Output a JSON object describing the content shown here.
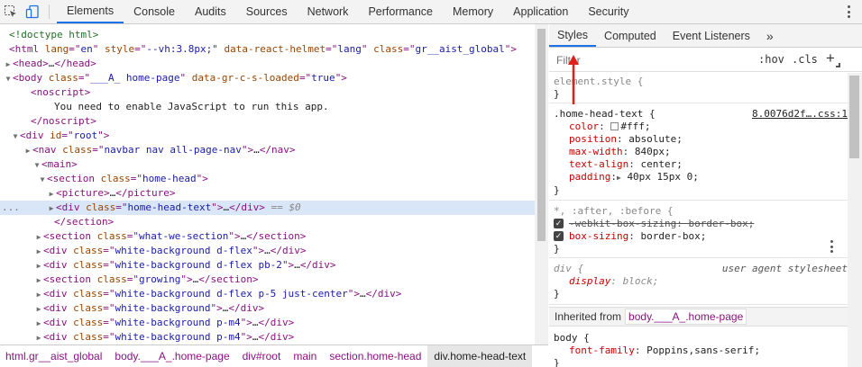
{
  "toolbar": {
    "tabs": [
      "Elements",
      "Console",
      "Audits",
      "Sources",
      "Network",
      "Performance",
      "Memory",
      "Application",
      "Security"
    ],
    "active_tab": "Elements"
  },
  "dom": {
    "lines": [
      {
        "parts": [
          [
            "c-comment",
            "<!doctype html>"
          ]
        ]
      },
      {
        "parts": [
          [
            "c-tag",
            "<html "
          ],
          [
            "c-attr",
            "lang"
          ],
          [
            "c-tag",
            "=\""
          ],
          [
            "c-val",
            "en"
          ],
          [
            "c-tag",
            "\" "
          ],
          [
            "c-attr",
            "style"
          ],
          [
            "c-tag",
            "=\""
          ],
          [
            "c-val",
            "--vh:3.8px;"
          ],
          [
            "c-tag",
            "\" "
          ],
          [
            "c-attr",
            "data-react-helmet"
          ],
          [
            "c-tag",
            "=\""
          ],
          [
            "c-val",
            "lang"
          ],
          [
            "c-tag",
            "\" "
          ],
          [
            "c-attr",
            "class"
          ],
          [
            "c-tag",
            "=\""
          ],
          [
            "c-val",
            "gr__aist_global"
          ],
          [
            "c-tag",
            "\">"
          ]
        ]
      },
      {
        "tri": "▶",
        "parts": [
          [
            "c-tag",
            "<head>"
          ],
          [
            "c-txt",
            "…"
          ],
          [
            "c-tag",
            "</head>"
          ]
        ]
      },
      {
        "tri": "▼",
        "parts": [
          [
            "c-tag",
            "<body "
          ],
          [
            "c-attr",
            "class"
          ],
          [
            "c-tag",
            "=\""
          ],
          [
            "c-val",
            "___A_ home-page"
          ],
          [
            "c-tag",
            "\" "
          ],
          [
            "c-attr",
            "data-gr-c-s-loaded"
          ],
          [
            "c-tag",
            "=\""
          ],
          [
            "c-val",
            "true"
          ],
          [
            "c-tag",
            "\">"
          ]
        ]
      },
      {
        "parts": [
          [
            "c-tag",
            "<noscript>"
          ]
        ]
      },
      {
        "parts": [
          [
            "c-txt",
            "You need to enable JavaScript to run this app."
          ]
        ]
      },
      {
        "parts": [
          [
            "c-tag",
            "</noscript>"
          ]
        ]
      },
      {
        "tri": "▼",
        "parts": [
          [
            "c-tag",
            "<div "
          ],
          [
            "c-attr",
            "id"
          ],
          [
            "c-tag",
            "=\""
          ],
          [
            "c-val",
            "root"
          ],
          [
            "c-tag",
            "\">"
          ]
        ]
      },
      {
        "tri": "▶",
        "parts": [
          [
            "c-tag",
            "<nav "
          ],
          [
            "c-attr",
            "class"
          ],
          [
            "c-tag",
            "=\""
          ],
          [
            "c-val",
            "navbar nav all-page-nav"
          ],
          [
            "c-tag",
            "\">"
          ],
          [
            "c-txt",
            "…"
          ],
          [
            "c-tag",
            "</nav>"
          ]
        ]
      },
      {
        "tri": "▼",
        "parts": [
          [
            "c-tag",
            "<main>"
          ]
        ]
      },
      {
        "tri": "▼",
        "parts": [
          [
            "c-tag",
            "<section "
          ],
          [
            "c-attr",
            "class"
          ],
          [
            "c-tag",
            "=\""
          ],
          [
            "c-val",
            "home-head"
          ],
          [
            "c-tag",
            "\">"
          ]
        ]
      },
      {
        "tri": "▶",
        "parts": [
          [
            "c-tag",
            "<picture>"
          ],
          [
            "c-txt",
            "…"
          ],
          [
            "c-tag",
            "</picture>"
          ]
        ]
      },
      {
        "tri": "▶",
        "parts": [
          [
            "c-tag",
            "<div "
          ],
          [
            "c-attr",
            "class"
          ],
          [
            "c-tag",
            "=\""
          ],
          [
            "c-val",
            "home-head-text"
          ],
          [
            "c-tag",
            "\">"
          ],
          [
            "c-txt",
            "…"
          ],
          [
            "c-tag",
            "</div>"
          ],
          [
            "c-eq",
            " == $0"
          ]
        ]
      },
      {
        "parts": [
          [
            "c-tag",
            "</section>"
          ]
        ]
      },
      {
        "tri": "▶",
        "parts": [
          [
            "c-tag",
            "<section "
          ],
          [
            "c-attr",
            "class"
          ],
          [
            "c-tag",
            "=\""
          ],
          [
            "c-val",
            "what-we-section"
          ],
          [
            "c-tag",
            "\">"
          ],
          [
            "c-txt",
            "…"
          ],
          [
            "c-tag",
            "</section>"
          ]
        ]
      },
      {
        "tri": "▶",
        "parts": [
          [
            "c-tag",
            "<div "
          ],
          [
            "c-attr",
            "class"
          ],
          [
            "c-tag",
            "=\""
          ],
          [
            "c-val",
            "white-background d-flex"
          ],
          [
            "c-tag",
            "\">"
          ],
          [
            "c-txt",
            "…"
          ],
          [
            "c-tag",
            "</div>"
          ]
        ]
      },
      {
        "tri": "▶",
        "parts": [
          [
            "c-tag",
            "<div "
          ],
          [
            "c-attr",
            "class"
          ],
          [
            "c-tag",
            "=\""
          ],
          [
            "c-val",
            "white-background d-flex pb-2"
          ],
          [
            "c-tag",
            "\">"
          ],
          [
            "c-txt",
            "…"
          ],
          [
            "c-tag",
            "</div>"
          ]
        ]
      },
      {
        "tri": "▶",
        "parts": [
          [
            "c-tag",
            "<section "
          ],
          [
            "c-attr",
            "class"
          ],
          [
            "c-tag",
            "=\""
          ],
          [
            "c-val",
            "growing"
          ],
          [
            "c-tag",
            "\">"
          ],
          [
            "c-txt",
            "…"
          ],
          [
            "c-tag",
            "</section>"
          ]
        ]
      },
      {
        "tri": "▶",
        "parts": [
          [
            "c-tag",
            "<div "
          ],
          [
            "c-attr",
            "class"
          ],
          [
            "c-tag",
            "=\""
          ],
          [
            "c-val",
            "white-background d-flex p-5 just-center"
          ],
          [
            "c-tag",
            "\">"
          ],
          [
            "c-txt",
            "…"
          ],
          [
            "c-tag",
            "</div>"
          ]
        ]
      },
      {
        "tri": "▶",
        "parts": [
          [
            "c-tag",
            "<div "
          ],
          [
            "c-attr",
            "class"
          ],
          [
            "c-tag",
            "=\""
          ],
          [
            "c-val",
            "white-background"
          ],
          [
            "c-tag",
            "\">"
          ],
          [
            "c-txt",
            "…"
          ],
          [
            "c-tag",
            "</div>"
          ]
        ]
      },
      {
        "tri": "▶",
        "parts": [
          [
            "c-tag",
            "<div "
          ],
          [
            "c-attr",
            "class"
          ],
          [
            "c-tag",
            "=\""
          ],
          [
            "c-val",
            "white-background p-m4"
          ],
          [
            "c-tag",
            "\">"
          ],
          [
            "c-txt",
            "…"
          ],
          [
            "c-tag",
            "</div>"
          ]
        ]
      },
      {
        "tri": "▶",
        "parts": [
          [
            "c-tag",
            "<div "
          ],
          [
            "c-attr",
            "class"
          ],
          [
            "c-tag",
            "=\""
          ],
          [
            "c-val",
            "white-background p-m4"
          ],
          [
            "c-tag",
            "\">"
          ],
          [
            "c-txt",
            "…"
          ],
          [
            "c-tag",
            "</div>"
          ]
        ]
      }
    ],
    "selected_dots": "..."
  },
  "breadcrumbs": [
    "html.gr__aist_global",
    "body.___A_.home-page",
    "div#root",
    "main",
    "section.home-head",
    "div.home-head-text"
  ],
  "styles": {
    "subtabs": [
      "Styles",
      "Computed",
      "Event Listeners"
    ],
    "more": "»",
    "filter_placeholder": "Filter",
    "hov": ":hov",
    "cls": ".cls",
    "plus": "+",
    "element_style": {
      "selector": "element.style {",
      "close": "}"
    },
    "rule1": {
      "selector": ".home-head-text {",
      "source": "8.0076d2f….css:1",
      "props": [
        {
          "name": "color",
          "value": "#fff;",
          "swatch": "#ffffff"
        },
        {
          "name": "position",
          "value": "absolute;"
        },
        {
          "name": "max-width",
          "value": "840px;"
        },
        {
          "name": "text-align",
          "value": "center;"
        },
        {
          "name": "padding",
          "value": "40px 15px 0;",
          "expand": "▶"
        }
      ],
      "close": "}"
    },
    "rule2": {
      "selector": "*, :after, :before {",
      "props": [
        {
          "name": "-webkit-box-sizing",
          "value": "border-box;",
          "struck": true
        },
        {
          "name": "box-sizing",
          "value": "border-box;"
        }
      ],
      "close": "}"
    },
    "rule3": {
      "selector": "div {",
      "source": "user agent stylesheet",
      "props": [
        {
          "name": "display",
          "value": "block;"
        }
      ],
      "close": "}"
    },
    "inherited": {
      "label": "Inherited from",
      "selector": "body.___A_.home-page"
    },
    "rule4": {
      "selector": "body {",
      "props": [
        {
          "name": "font-family",
          "value": "Poppins,sans-serif;"
        }
      ],
      "close": "}"
    }
  }
}
